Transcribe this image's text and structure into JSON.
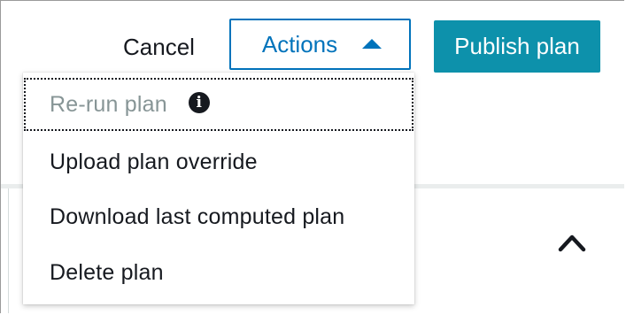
{
  "header": {
    "cancel_label": "Cancel",
    "actions_label": "Actions",
    "publish_label": "Publish plan"
  },
  "actions_menu": {
    "items": [
      {
        "label": "Re-run plan",
        "state": "disabled",
        "icon": "info-icon",
        "icon_glyph": "i"
      },
      {
        "label": "Upload plan override",
        "state": "enabled"
      },
      {
        "label": "Download last computed plan",
        "state": "enabled"
      },
      {
        "label": "Delete plan",
        "state": "enabled"
      }
    ]
  },
  "panel": {
    "toggle_icon": "chevron-up-icon"
  },
  "colors": {
    "accent": "#0073bb",
    "primary_button": "#0d91ab",
    "text": "#16191f",
    "disabled_text": "#879596"
  }
}
